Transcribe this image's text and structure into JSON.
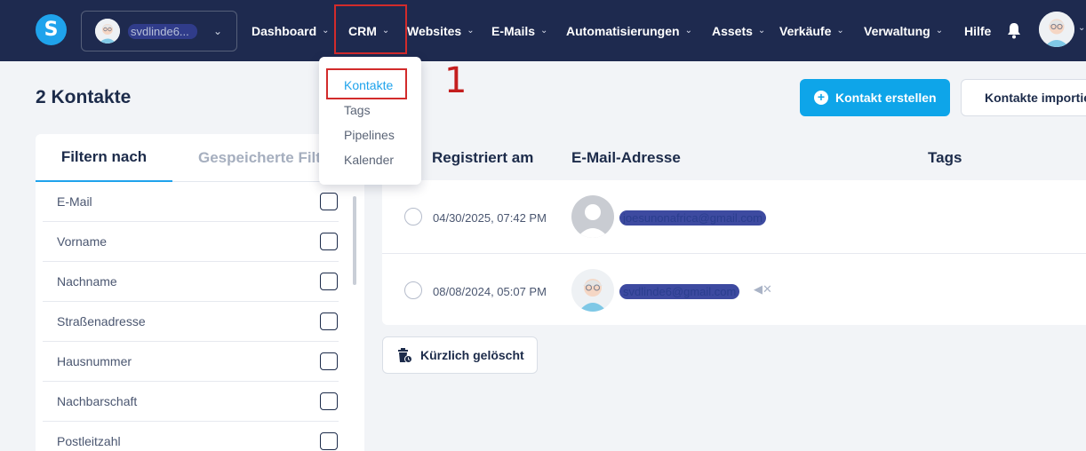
{
  "topbar": {
    "logo_letter": "S",
    "site_name": "svdlinde6...",
    "nav": [
      {
        "label": "Dashboard"
      },
      {
        "label": "CRM"
      },
      {
        "label": "Websites"
      },
      {
        "label": "E-Mails"
      },
      {
        "label": "Automatisierungen"
      },
      {
        "label": "Assets"
      },
      {
        "label": "Verkäufe"
      },
      {
        "label": "Verwaltung"
      },
      {
        "label": "Hilfe"
      }
    ]
  },
  "dropdown": {
    "items": [
      {
        "label": "Kontakte"
      },
      {
        "label": "Tags"
      },
      {
        "label": "Pipelines"
      },
      {
        "label": "Kalender"
      }
    ]
  },
  "annotation": "1",
  "page": {
    "title": "2 Kontakte",
    "create_button": "Kontakt erstellen",
    "import_button": "Kontakte importieren"
  },
  "filter": {
    "tab_active": "Filtern nach",
    "tab_inactive": "Gespeicherte Filter",
    "fields": [
      {
        "label": "E-Mail"
      },
      {
        "label": "Vorname"
      },
      {
        "label": "Nachname"
      },
      {
        "label": "Straßenadresse"
      },
      {
        "label": "Hausnummer"
      },
      {
        "label": "Nachbarschaft"
      },
      {
        "label": "Postleitzahl"
      }
    ]
  },
  "table": {
    "headers": {
      "registered": "Registriert am",
      "email": "E-Mail-Adresse",
      "tags": "Tags"
    },
    "rows": [
      {
        "date": "04/30/2025, 07:42 PM",
        "email": "joesunonafrica@gmail.com",
        "avatar": "default-avatar-icon"
      },
      {
        "date": "08/08/2024, 05:07 PM",
        "email": "svdlinde6@gmail.com",
        "avatar": "user-avatar"
      }
    ]
  },
  "recently_deleted": "Kürzlich gelöscht",
  "colors": {
    "nav_bg": "#1e2a4f",
    "accent": "#0ea5e9",
    "highlight": "#d22b2b"
  }
}
